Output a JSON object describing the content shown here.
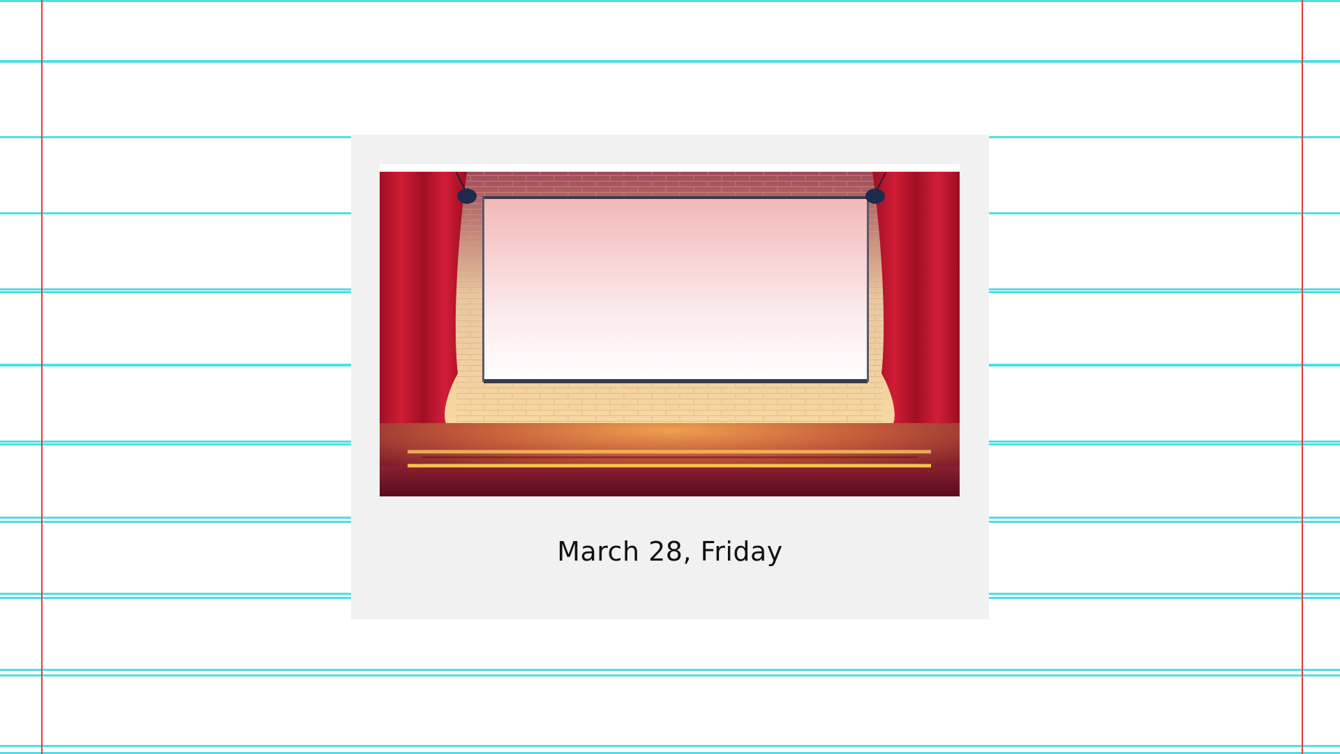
{
  "page": {
    "background": "#ffffff",
    "rule_color": "#4fdde6",
    "margin_color": "#e03a3a"
  },
  "photo_card": {
    "image": "stage-with-red-curtains-and-blank-projection-screen",
    "caption": "March 28, Friday",
    "card_color": "#f1f1f1"
  }
}
